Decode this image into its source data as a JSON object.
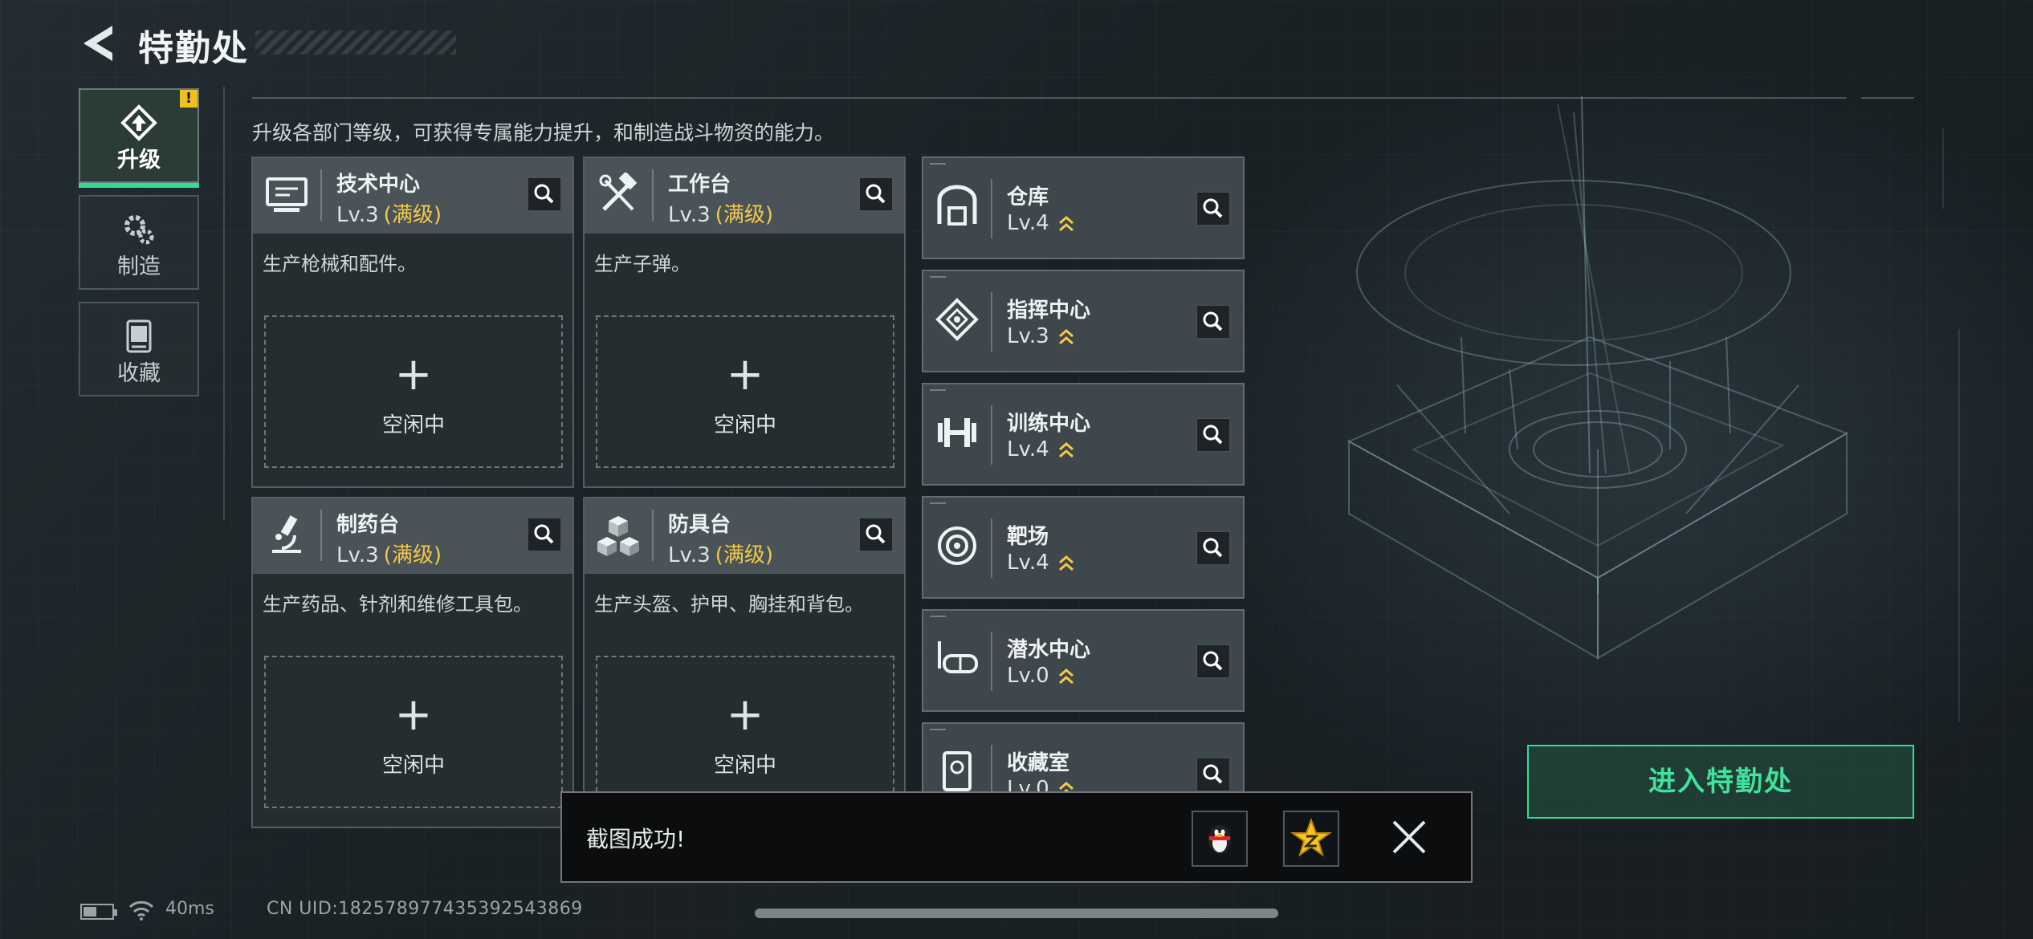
{
  "header": {
    "title": "特勤处"
  },
  "nav": [
    {
      "label": "升级",
      "active": true,
      "badge": "!"
    },
    {
      "label": "制造",
      "active": false
    },
    {
      "label": "收藏",
      "active": false
    }
  ],
  "intro": "升级各部门等级，可获得专属能力提升，和制造战斗物资的能力。",
  "departments": [
    {
      "name": "技术中心",
      "level": "Lv.3",
      "max": "(满级)",
      "desc": "生产枪械和配件。",
      "status": "空闲中"
    },
    {
      "name": "工作台",
      "level": "Lv.3",
      "max": "(满级)",
      "desc": "生产子弹。",
      "status": "空闲中"
    },
    {
      "name": "制药台",
      "level": "Lv.3",
      "max": "(满级)",
      "desc": "生产药品、针剂和维修工具包。",
      "status": "空闲中"
    },
    {
      "name": "防具台",
      "level": "Lv.3",
      "max": "(满级)",
      "desc": "生产头盔、护甲、胸挂和背包。",
      "status": "空闲中"
    }
  ],
  "facilities": [
    {
      "name": "仓库",
      "level": "Lv.4",
      "icon": "warehouse-icon"
    },
    {
      "name": "指挥中心",
      "level": "Lv.3",
      "icon": "command-icon"
    },
    {
      "name": "训练中心",
      "level": "Lv.4",
      "icon": "dumbbell-icon"
    },
    {
      "name": "靶场",
      "level": "Lv.4",
      "icon": "target-icon"
    },
    {
      "name": "潜水中心",
      "level": "Lv.0",
      "icon": "dive-mask-icon"
    },
    {
      "name": "收藏室",
      "level": "Lv.0",
      "icon": "collection-icon"
    }
  ],
  "enter_button": "进入特勤处",
  "toast": {
    "message": "截图成功!"
  },
  "status": {
    "ping": "40ms",
    "uid": "CN UID:182578977435392543869"
  },
  "colors": {
    "accent": "#2ee08f",
    "max_level": "#f4c84a",
    "alert": "#f2c01d"
  }
}
